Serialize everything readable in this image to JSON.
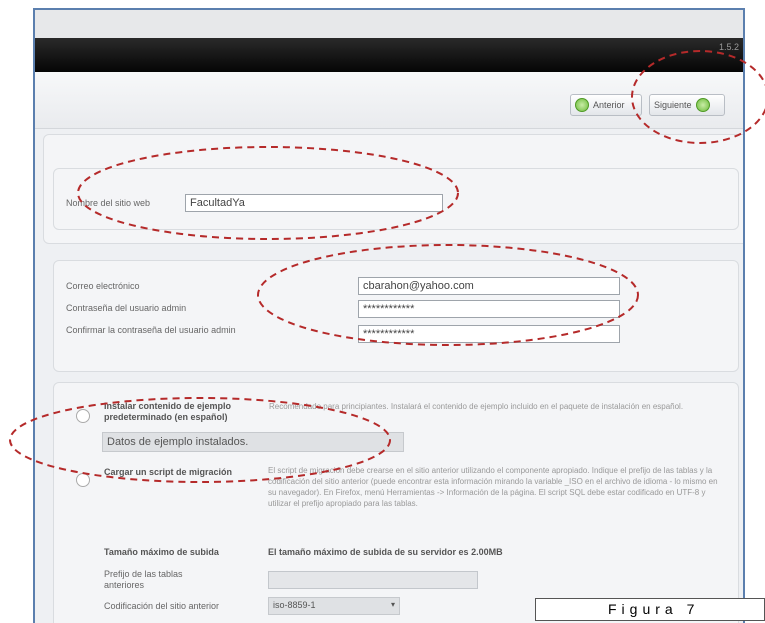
{
  "toolbar": {
    "back_label": "Anterior",
    "next_label": "Siguiente"
  },
  "header": {
    "version_text": "1.5.2"
  },
  "site": {
    "site_name_label": "Nombre del sitio web",
    "site_name_value": "FacultadYa"
  },
  "admin": {
    "email_label": "Correo electrónico",
    "email_value": "cbarahon@yahoo.com",
    "password_label": "Contraseña del usuario admin",
    "password_value": "************",
    "confirm_label": "Confirmar la contraseña del usuario admin",
    "confirm_value": "************"
  },
  "sample": {
    "install_label": "Instalar contenido de ejemplo predeterminado (en español)",
    "install_desc": "Recomendado para principiantes. Instalará el contenido de ejemplo incluido en el paquete de instalación en español.",
    "installed_status": "Datos de ejemplo instalados.",
    "migration_label": "Cargar un script de migración",
    "migration_desc": "El script de migración debe crearse en el sitio anterior utilizando el componente apropiado. Indique el prefijo de las tablas y la codificación del sitio anterior (puede encontrar esta información mirando la variable _ISO en el archivo de idioma - lo mismo en su navegador). En Firefox, menú Herramientas -> Información de la página. El script SQL debe estar codificado en UTF-8 y utilizar el prefijo apropiado para las tablas.",
    "max_upload_label": "Tamaño máximo de subida",
    "max_upload_value": "El tamaño máximo de subida de su servidor es 2.00MB",
    "prefix_label": "Prefijo de las tablas anteriores",
    "encoding_label": "Codificación del sitio anterior",
    "encoding_value": "iso-8859-1"
  },
  "figure": {
    "caption": "Figura 7"
  },
  "colors": {
    "frame_border": "#5b7fae",
    "annotation": "#b52a2a",
    "accent_green": "#6cbb3a"
  }
}
